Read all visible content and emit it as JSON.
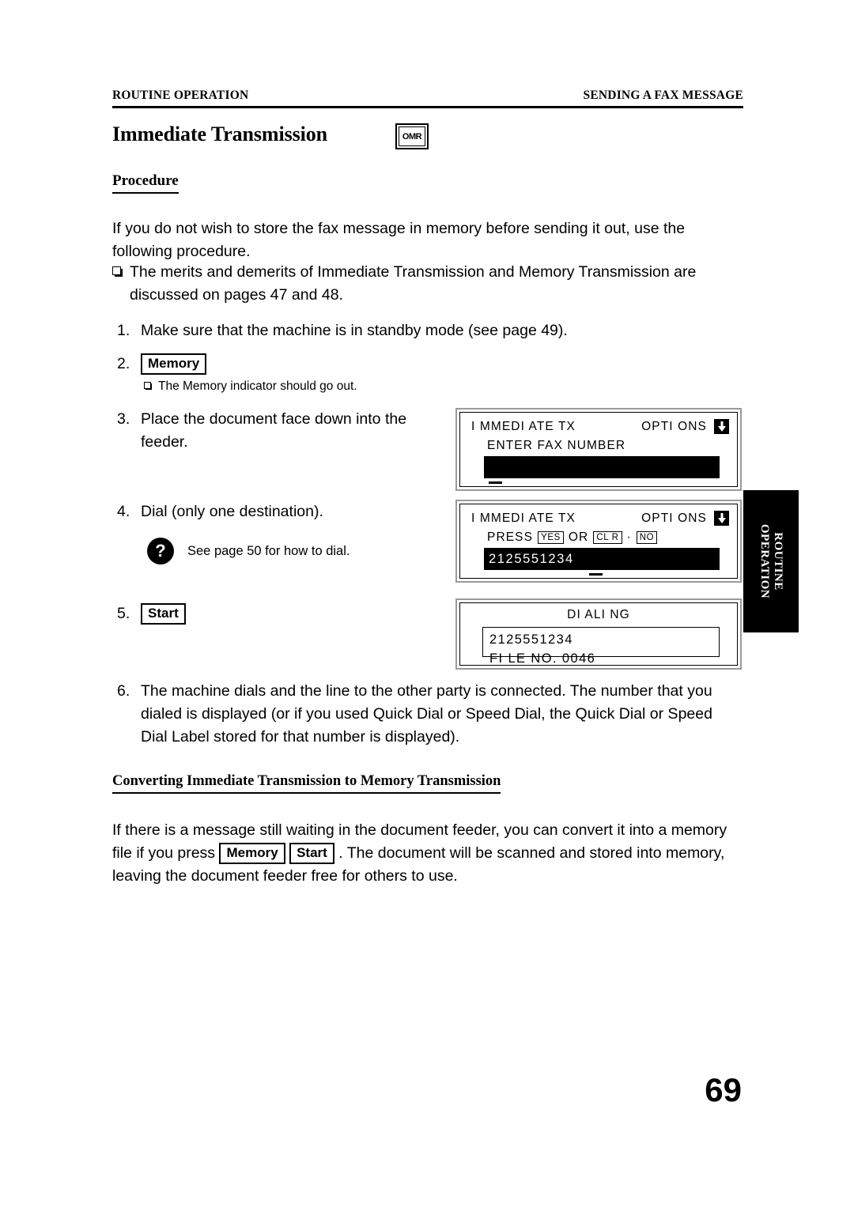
{
  "header": {
    "left": "ROUTINE OPERATION",
    "right": "SENDING A FAX MESSAGE"
  },
  "title": "Immediate Transmission",
  "title_badge": "OMR",
  "procedure_heading": "Procedure",
  "intro_paragraph": "If you do not wish to store the fax message in memory before sending it out, use the following procedure.",
  "merits_note": "The merits and demerits of Immediate Transmission and Memory Transmission are discussed on pages 47 and 48.",
  "steps": [
    {
      "num": "1.",
      "text": "Make sure that the machine is in standby mode (see page 49)."
    },
    {
      "num": "2.",
      "key": "Memory",
      "note": "The Memory indicator should go out."
    },
    {
      "num": "3.",
      "text": "Place the document face down into the feeder."
    },
    {
      "num": "4.",
      "text": "Dial (only one destination).",
      "help_icon": "?",
      "help": "See page 50 for how to dial."
    },
    {
      "num": "5.",
      "key": "Start"
    },
    {
      "num": "6.",
      "text": "The machine dials and the line to the other party is connected. The number that you dialed is displayed (or if you used Quick Dial or Speed Dial, the Quick Dial or Speed Dial Label stored for that number is displayed)."
    }
  ],
  "lcd_panels": [
    {
      "status": "I MMEDI ATE TX",
      "options_label": "OPTI ONS",
      "options_icon": "arrow-down-icon",
      "prompt": "ENTER FAX NUMBER",
      "field_value": ""
    },
    {
      "status": "I MMEDI ATE TX",
      "options_label": "OPTI ONS",
      "options_icon": "arrow-down-icon",
      "prompt_prefix": "PRESS",
      "key_yes": "YES",
      "prompt_mid": "OR",
      "key_clr": "CL R",
      "prompt_sep": "·",
      "key_no": "NO",
      "field_value": "2125551234"
    },
    {
      "title": "DI ALI NG",
      "line1": "2125551234",
      "line2": "FI LE NO.  0046"
    }
  ],
  "side_tab": {
    "line1": "ROUTINE",
    "line2": "OPERATION"
  },
  "converting_heading": "Converting Immediate Transmission to Memory Transmission",
  "converting_paragraph": {
    "part1": "If there is a message still waiting in the document feeder, you can convert it into a memory file if you press",
    "key1": "Memory",
    "key2": "Start",
    "part2": ". The document will be scanned and stored into memory, leaving the document feeder free for others to use."
  },
  "page_number": "69"
}
